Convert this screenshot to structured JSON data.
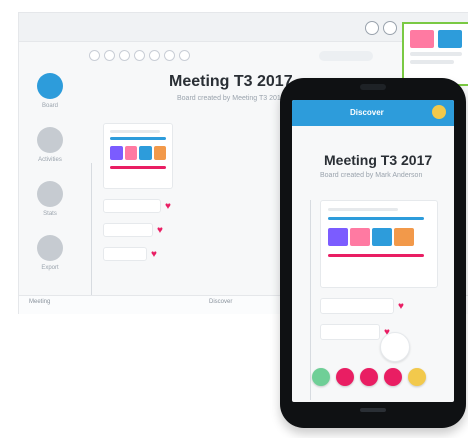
{
  "desktop": {
    "sidebar": {
      "items": [
        {
          "label": "Board",
          "icon": "chat-icon"
        },
        {
          "label": "Activities",
          "icon": "tools-icon"
        },
        {
          "label": "Stats",
          "icon": "chart-icon"
        },
        {
          "label": "Export",
          "icon": "export-icon"
        }
      ]
    },
    "title": "Meeting T3 2017",
    "subtitle": "Board created by Meeting T3 2017",
    "bottom": {
      "left": "Meeting",
      "right": "Discover"
    }
  },
  "phone": {
    "topbar": {
      "title": "Discover"
    },
    "title": "Meeting T3 2017",
    "subtitle": "Board created by Mark Anderson"
  },
  "colors": {
    "accent": "#2d9cdb",
    "pink": "#e91e63",
    "green": "#7ac943"
  }
}
